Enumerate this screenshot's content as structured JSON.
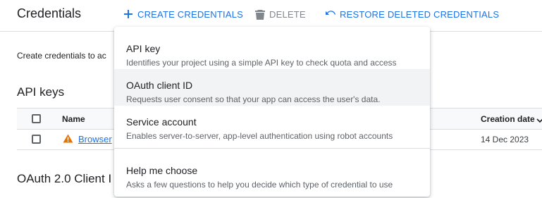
{
  "header": {
    "title": "Credentials",
    "create_label": "CREATE CREDENTIALS",
    "delete_label": "DELETE",
    "restore_label": "RESTORE DELETED CREDENTIALS"
  },
  "intro_text": "Create credentials to ac",
  "api_keys": {
    "title": "API keys",
    "columns": {
      "name": "Name",
      "creation_date": "Creation date"
    },
    "rows": [
      {
        "name": "Browser",
        "creation_date": "14 Dec 2023",
        "warning": true
      }
    ]
  },
  "oauth_section_title": "OAuth 2.0 Client I",
  "menu": {
    "items": [
      {
        "title": "API key",
        "description": "Identifies your project using a simple API key to check quota and access"
      },
      {
        "title": "OAuth client ID",
        "description": "Requests user consent so that your app can access the user's data.",
        "highlighted": true
      },
      {
        "title": "Service account",
        "description": "Enables server-to-server, app-level authentication using robot accounts"
      },
      {
        "title": "Help me choose",
        "description": "Asks a few questions to help you decide which type of credential to use"
      }
    ]
  },
  "colors": {
    "accent": "#1a73e8",
    "warning": "#e37400",
    "disabled": "#80868b"
  },
  "icons": [
    "plus-icon",
    "trash-icon",
    "restore-icon",
    "warning-icon",
    "sort-arrow-icon"
  ]
}
